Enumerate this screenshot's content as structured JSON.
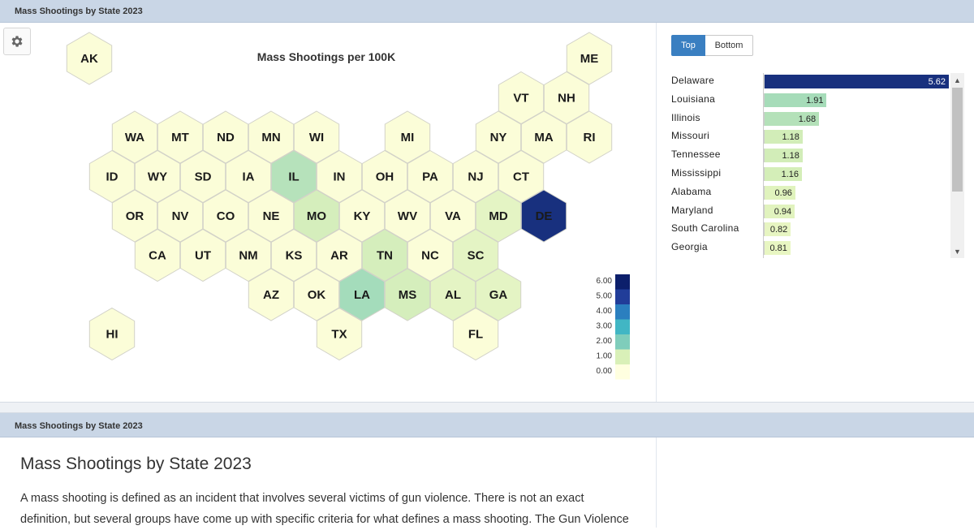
{
  "top_panel": {
    "title": "Mass Shootings by State 2023"
  },
  "bottom_panel": {
    "title": "Mass Shootings by State 2023"
  },
  "map": {
    "title": "Mass Shootings per 100K",
    "hexes": [
      {
        "abbr": "AK",
        "value": 0,
        "row": 0,
        "col": 0
      },
      {
        "abbr": "ME",
        "value": 0,
        "row": 0,
        "col": 11
      },
      {
        "abbr": "VT",
        "value": 0,
        "row": 1,
        "col": 10
      },
      {
        "abbr": "NH",
        "value": 0,
        "row": 1,
        "col": 11
      },
      {
        "abbr": "WA",
        "value": 0,
        "row": 2,
        "col": 1
      },
      {
        "abbr": "MT",
        "value": 0,
        "row": 2,
        "col": 2
      },
      {
        "abbr": "ND",
        "value": 0,
        "row": 2,
        "col": 3
      },
      {
        "abbr": "MN",
        "value": 0,
        "row": 2,
        "col": 4
      },
      {
        "abbr": "WI",
        "value": 0,
        "row": 2,
        "col": 5
      },
      {
        "abbr": "MI",
        "value": 0,
        "row": 2,
        "col": 7
      },
      {
        "abbr": "NY",
        "value": 0,
        "row": 2,
        "col": 9
      },
      {
        "abbr": "MA",
        "value": 0,
        "row": 2,
        "col": 10
      },
      {
        "abbr": "RI",
        "value": 0,
        "row": 2,
        "col": 11
      },
      {
        "abbr": "ID",
        "value": 0,
        "row": 3,
        "col": 1
      },
      {
        "abbr": "WY",
        "value": 0,
        "row": 3,
        "col": 2
      },
      {
        "abbr": "SD",
        "value": 0,
        "row": 3,
        "col": 3
      },
      {
        "abbr": "IA",
        "value": 0,
        "row": 3,
        "col": 4
      },
      {
        "abbr": "IL",
        "value": 1.68,
        "row": 3,
        "col": 5
      },
      {
        "abbr": "IN",
        "value": 0,
        "row": 3,
        "col": 6
      },
      {
        "abbr": "OH",
        "value": 0,
        "row": 3,
        "col": 7
      },
      {
        "abbr": "PA",
        "value": 0,
        "row": 3,
        "col": 8
      },
      {
        "abbr": "NJ",
        "value": 0,
        "row": 3,
        "col": 9
      },
      {
        "abbr": "CT",
        "value": 0,
        "row": 3,
        "col": 10
      },
      {
        "abbr": "OR",
        "value": 0,
        "row": 4,
        "col": 1
      },
      {
        "abbr": "NV",
        "value": 0,
        "row": 4,
        "col": 2
      },
      {
        "abbr": "CO",
        "value": 0,
        "row": 4,
        "col": 3
      },
      {
        "abbr": "NE",
        "value": 0,
        "row": 4,
        "col": 4
      },
      {
        "abbr": "MO",
        "value": 1.18,
        "row": 4,
        "col": 5
      },
      {
        "abbr": "KY",
        "value": 0,
        "row": 4,
        "col": 6
      },
      {
        "abbr": "WV",
        "value": 0,
        "row": 4,
        "col": 7
      },
      {
        "abbr": "VA",
        "value": 0,
        "row": 4,
        "col": 8
      },
      {
        "abbr": "MD",
        "value": 0.94,
        "row": 4,
        "col": 9
      },
      {
        "abbr": "DE",
        "value": 5.62,
        "row": 4,
        "col": 10
      },
      {
        "abbr": "CA",
        "value": 0,
        "row": 5,
        "col": 2
      },
      {
        "abbr": "UT",
        "value": 0,
        "row": 5,
        "col": 3
      },
      {
        "abbr": "NM",
        "value": 0,
        "row": 5,
        "col": 4
      },
      {
        "abbr": "KS",
        "value": 0,
        "row": 5,
        "col": 5
      },
      {
        "abbr": "AR",
        "value": 0,
        "row": 5,
        "col": 6
      },
      {
        "abbr": "TN",
        "value": 1.18,
        "row": 5,
        "col": 7
      },
      {
        "abbr": "NC",
        "value": 0,
        "row": 5,
        "col": 8
      },
      {
        "abbr": "SC",
        "value": 0.82,
        "row": 5,
        "col": 9
      },
      {
        "abbr": "AZ",
        "value": 0,
        "row": 6,
        "col": 4
      },
      {
        "abbr": "OK",
        "value": 0,
        "row": 6,
        "col": 5
      },
      {
        "abbr": "LA",
        "value": 1.91,
        "row": 6,
        "col": 6
      },
      {
        "abbr": "MS",
        "value": 1.16,
        "row": 6,
        "col": 7
      },
      {
        "abbr": "AL",
        "value": 0.96,
        "row": 6,
        "col": 8
      },
      {
        "abbr": "GA",
        "value": 0.81,
        "row": 6,
        "col": 9
      },
      {
        "abbr": "HI",
        "value": 0,
        "row": 7,
        "col": 1
      },
      {
        "abbr": "TX",
        "value": 0,
        "row": 7,
        "col": 6
      },
      {
        "abbr": "FL",
        "value": 0,
        "row": 7,
        "col": 9
      }
    ],
    "legend": {
      "labels": [
        "6.00",
        "5.00",
        "4.00",
        "3.00",
        "2.00",
        "1.00",
        "0.00"
      ],
      "colors": [
        "#0c1f6b",
        "#213d99",
        "#2b7fbf",
        "#41b6c4",
        "#7fcdbb",
        "#d9f0b8",
        "#ffffe0"
      ]
    }
  },
  "ranking": {
    "toggle": {
      "top_label": "Top",
      "bottom_label": "Bottom",
      "selected": "Top"
    },
    "max": 5.62,
    "rows": [
      {
        "state": "Delaware",
        "value": 5.62,
        "label": "5.62",
        "color": "#18307e",
        "text_color": "#ffffff"
      },
      {
        "state": "Louisiana",
        "value": 1.91,
        "label": "1.91",
        "color": "#a6dcb9",
        "text_color": "#222222"
      },
      {
        "state": "Illinois",
        "value": 1.68,
        "label": "1.68",
        "color": "#b4e1b9",
        "text_color": "#222222"
      },
      {
        "state": "Missouri",
        "value": 1.18,
        "label": "1.18",
        "color": "#d2edb8",
        "text_color": "#222222"
      },
      {
        "state": "Tennessee",
        "value": 1.18,
        "label": "1.18",
        "color": "#d2edb8",
        "text_color": "#222222"
      },
      {
        "state": "Mississippi",
        "value": 1.16,
        "label": "1.16",
        "color": "#d4eeb8",
        "text_color": "#222222"
      },
      {
        "state": "Alabama",
        "value": 0.96,
        "label": "0.96",
        "color": "#e0f3bd",
        "text_color": "#222222"
      },
      {
        "state": "Maryland",
        "value": 0.94,
        "label": "0.94",
        "color": "#e1f3be",
        "text_color": "#222222"
      },
      {
        "state": "South Carolina",
        "value": 0.82,
        "label": "0.82",
        "color": "#e7f5c2",
        "text_color": "#222222"
      },
      {
        "state": "Georgia",
        "value": 0.81,
        "label": "0.81",
        "color": "#e8f6c2",
        "text_color": "#222222"
      }
    ]
  },
  "article": {
    "heading": "Mass Shootings by State 2023",
    "body": "A mass shooting is defined as an incident that involves several victims of gun violence. There is not an exact definition, but several groups have come up with specific criteria for what defines a mass shooting. The Gun Violence"
  },
  "icons": {
    "settings": "gear-icon",
    "scroll_up": "chevron-up-icon",
    "scroll_down": "chevron-down-icon"
  }
}
